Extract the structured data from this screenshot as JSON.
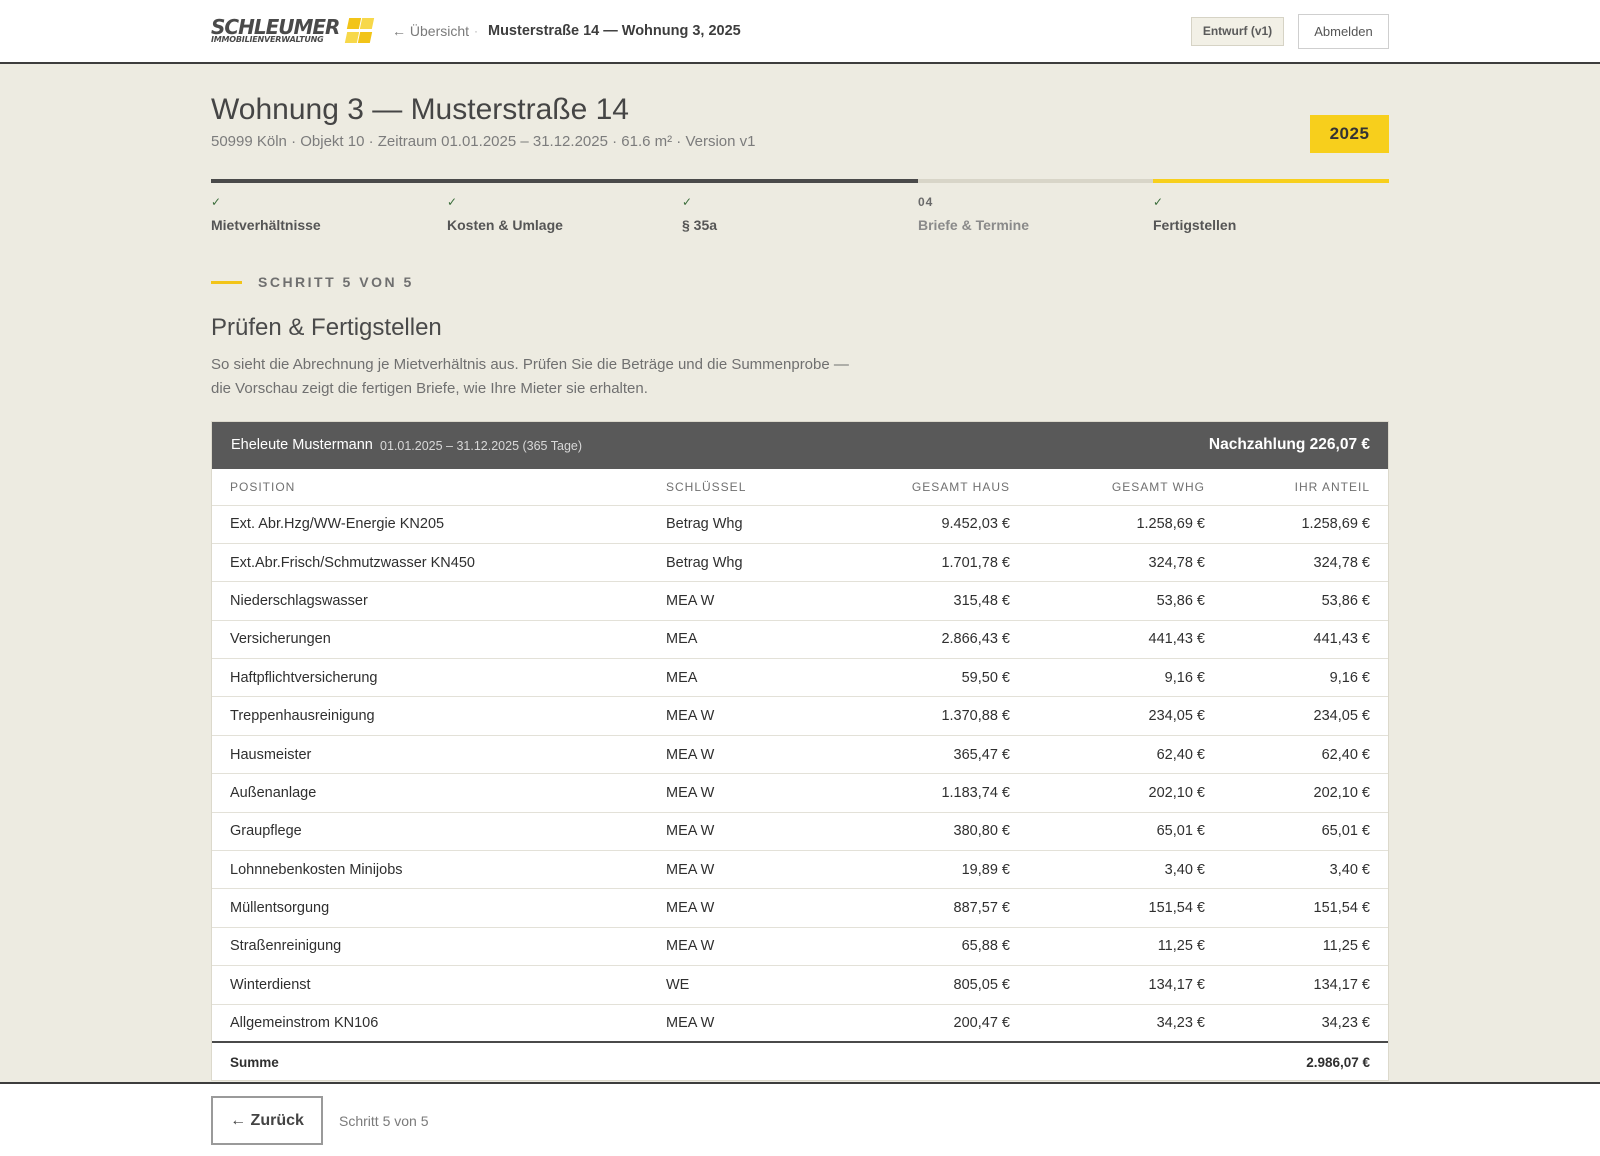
{
  "header": {
    "logo_word": "SCHLEUMER",
    "logo_sub": "IMMOBILIENVERWALTUNG",
    "back_label": "← Übersicht",
    "separator": "·",
    "breadcrumb": "Musterstraße 14 — Wohnung 3, 2025",
    "draft_badge": "Entwurf (v1)",
    "logout_label": "Abmelden",
    "accent_color": "#f7cf1c"
  },
  "page": {
    "title": "Wohnung 3 — Musterstraße 14",
    "subtitle": "50999 Köln · Objekt 10 · Zeitraum 01.01.2025 – 31.12.2025 · 61.6 m² · Version v1",
    "year": "2025"
  },
  "stepper": {
    "steps": [
      {
        "mark": "✓",
        "label": "Mietverhältnisse",
        "state": "done"
      },
      {
        "mark": "✓",
        "label": "Kosten & Umlage",
        "state": "done"
      },
      {
        "mark": "✓",
        "label": "§ 35a",
        "state": "done"
      },
      {
        "mark": "04",
        "label": "Briefe & Termine",
        "state": "open"
      },
      {
        "mark": "✓",
        "label": "Fertigstellen",
        "state": "current"
      }
    ]
  },
  "section": {
    "kicker": "SCHRITT 5 VON 5",
    "title": "Prüfen & Fertigstellen",
    "description": "So sieht die Abrechnung je Mietverhältnis aus. Prüfen Sie die Beträge und die Summenprobe — die Vorschau zeigt die fertigen Briefe, wie Ihre Mieter sie erhalten."
  },
  "statement": {
    "tenant": "Eheleute Mustermann",
    "period": "01.01.2025 – 31.12.2025 (365 Tage)",
    "result": "Nachzahlung 226,07 €",
    "columns": [
      "POSITION",
      "SCHLÜSSEL",
      "GESAMT HAUS",
      "GESAMT WHG",
      "IHR ANTEIL"
    ],
    "rows": [
      [
        "Ext. Abr.Hzg/WW-Energie KN205",
        "Betrag Whg",
        "9.452,03 €",
        "1.258,69 €",
        "1.258,69 €"
      ],
      [
        "Ext.Abr.Frisch/Schmutzwasser KN450",
        "Betrag Whg",
        "1.701,78 €",
        "324,78 €",
        "324,78 €"
      ],
      [
        "Niederschlagswasser",
        "MEA W",
        "315,48 €",
        "53,86 €",
        "53,86 €"
      ],
      [
        "Versicherungen",
        "MEA",
        "2.866,43 €",
        "441,43 €",
        "441,43 €"
      ],
      [
        "Haftpflichtversicherung",
        "MEA",
        "59,50 €",
        "9,16 €",
        "9,16 €"
      ],
      [
        "Treppenhausreinigung",
        "MEA W",
        "1.370,88 €",
        "234,05 €",
        "234,05 €"
      ],
      [
        "Hausmeister",
        "MEA W",
        "365,47 €",
        "62,40 €",
        "62,40 €"
      ],
      [
        "Außenanlage",
        "MEA W",
        "1.183,74 €",
        "202,10 €",
        "202,10 €"
      ],
      [
        "Graupflege",
        "MEA W",
        "380,80 €",
        "65,01 €",
        "65,01 €"
      ],
      [
        "Lohnnebenkosten Minijobs",
        "MEA W",
        "19,89 €",
        "3,40 €",
        "3,40 €"
      ],
      [
        "Müllentsorgung",
        "MEA W",
        "887,57 €",
        "151,54 €",
        "151,54 €"
      ],
      [
        "Straßenreinigung",
        "MEA W",
        "65,88 €",
        "11,25 €",
        "11,25 €"
      ],
      [
        "Winterdienst",
        "WE",
        "805,05 €",
        "134,17 €",
        "134,17 €"
      ],
      [
        "Allgemeinstrom KN106",
        "MEA W",
        "200,47 €",
        "34,23 €",
        "34,23 €"
      ]
    ],
    "sum_label": "Summe",
    "sum_value": "2.986,07 €"
  },
  "footer": {
    "back_label": "← Zurück",
    "step_info": "Schritt 5 von 5"
  }
}
